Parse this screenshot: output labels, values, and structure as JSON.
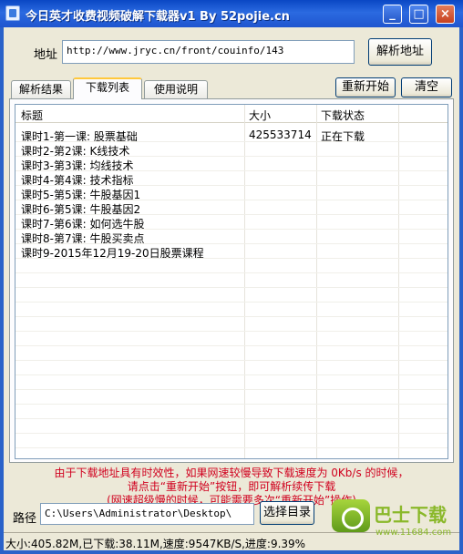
{
  "window": {
    "title": "今日英才收费视频破解下载器v1 By 52pojie.cn",
    "controls": {
      "minimize": "_",
      "maximize": "□",
      "close": "×"
    }
  },
  "address": {
    "label": "地址",
    "value": "http://www.jryc.cn/front/couinfo/143",
    "parse_button": "解析地址"
  },
  "tabs": [
    {
      "label": "解析结果",
      "active": false
    },
    {
      "label": "下载列表",
      "active": true
    },
    {
      "label": "使用说明",
      "active": false
    }
  ],
  "actions": {
    "restart": "重新开始",
    "clear": "清空"
  },
  "list": {
    "columns": [
      "标题",
      "大小",
      "下载状态"
    ],
    "rows": [
      {
        "title": "课时1-第一课: 股票基础",
        "size": "425533714",
        "status": "正在下载"
      },
      {
        "title": "课时2-第2课: K线技术",
        "size": "",
        "status": ""
      },
      {
        "title": "课时3-第3课: 均线技术",
        "size": "",
        "status": ""
      },
      {
        "title": "课时4-第4课: 技术指标",
        "size": "",
        "status": ""
      },
      {
        "title": "课时5-第5课: 牛股基因1",
        "size": "",
        "status": ""
      },
      {
        "title": "课时6-第5课: 牛股基因2",
        "size": "",
        "status": ""
      },
      {
        "title": "课时7-第6课: 如何选牛股",
        "size": "",
        "status": ""
      },
      {
        "title": "课时8-第7课: 牛股买卖点",
        "size": "",
        "status": ""
      },
      {
        "title": "课时9-2015年12月19-20日股票课程",
        "size": "",
        "status": ""
      }
    ]
  },
  "notice": {
    "line1": "由于下载地址具有时效性，如果网速较慢导致下载速度为 0Kb/s 的时候，",
    "line2": "请点击“重新开始”按钮，即可解析续传下载",
    "line3": "(网速超级慢的时候，可能需要多次“重新开始”操作)"
  },
  "path": {
    "label": "路径",
    "value": "C:\\Users\\Administrator\\Desktop\\",
    "choose_button": "选择目录"
  },
  "status_bar": "大小:405.82M,已下载:38.11M,速度:9547KB/S,进度:9.39%",
  "watermark": {
    "name": "巴士下载",
    "url": "www.11684.com"
  },
  "colors": {
    "titlebar": "#0a47c4",
    "notice": "#d0001e",
    "window_bg": "#ece9d8"
  }
}
